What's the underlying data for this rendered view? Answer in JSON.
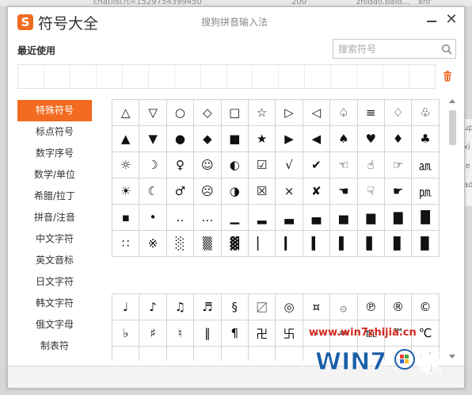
{
  "background": {
    "partial_text": "chatlist?t=1529754399450",
    "partial_number": "200",
    "partial_domain": "zhidao.baid...",
    "partial_type": "xhr",
    "right_edge_lines": [
      "up",
      "xi",
      "ie",
      "ad"
    ]
  },
  "window": {
    "logo_letter": "S",
    "title": "符号大全",
    "ime_name": "搜狗拼音输入法",
    "close_glyph": "✕"
  },
  "recent": {
    "label": "最近使用",
    "slots": 16
  },
  "search": {
    "placeholder": "搜索符号"
  },
  "sidebar": {
    "items": [
      {
        "label": "特殊符号",
        "active": true
      },
      {
        "label": "标点符号"
      },
      {
        "label": "数字序号"
      },
      {
        "label": "数学/单位"
      },
      {
        "label": "希腊/拉丁"
      },
      {
        "label": "拼音/注音"
      },
      {
        "label": "中文字符"
      },
      {
        "label": "英文音标"
      },
      {
        "label": "日文字符"
      },
      {
        "label": "韩文字符"
      },
      {
        "label": "俄文字母"
      },
      {
        "label": "制表符"
      }
    ]
  },
  "symbol_grids": [
    {
      "rows": [
        [
          "△",
          "▽",
          "○",
          "◇",
          "□",
          "☆",
          "▷",
          "◁",
          "♤",
          "≡",
          "♢",
          "♧"
        ],
        [
          "▲",
          "▼",
          "●",
          "◆",
          "■",
          "★",
          "▶",
          "◀",
          "♠",
          "♥",
          "♦",
          "♣"
        ],
        [
          "☼",
          "☽",
          "♀",
          "☺",
          "◐",
          "☑",
          "√",
          "✔",
          "☜",
          "☝",
          "☞",
          "㏂"
        ],
        [
          "☀",
          "☾",
          "♂",
          "☹",
          "◑",
          "☒",
          "×",
          "✘",
          "☚",
          "☟",
          "☛",
          "㏘"
        ],
        [
          "▪",
          "•",
          "‥",
          "…",
          "▁",
          "▂",
          "▃",
          "▄",
          "▅",
          "▆",
          "▇",
          "█"
        ],
        [
          "∷",
          "※",
          "░",
          "▒",
          "▓",
          "▏",
          "▎",
          "▍",
          "▌",
          "▋",
          "▊",
          "▉"
        ]
      ]
    },
    {
      "rows": [
        [
          "♩",
          "♪",
          "♫",
          "♬",
          "§",
          "〼",
          "◎",
          "¤",
          "۞",
          "℗",
          "®",
          "©"
        ],
        [
          "♭",
          "♯",
          "♮",
          "‖",
          "¶",
          "卍",
          "卐",
          "‐",
          "═",
          "℡",
          "™",
          "℃"
        ],
        [
          "",
          "",
          "",
          "",
          "",
          "",
          "",
          "",
          "",
          "",
          "",
          ""
        ]
      ]
    }
  ],
  "watermark": {
    "url": "www.win7zhijia.cn",
    "brand": "WIN7",
    "suffix": "家"
  }
}
